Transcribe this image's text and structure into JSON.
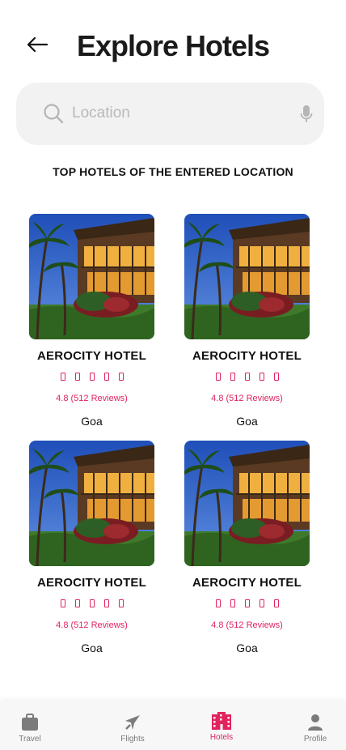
{
  "header": {
    "title": "Explore Hotels"
  },
  "search": {
    "placeholder": "Location",
    "value": ""
  },
  "section_title": "TOP HOTELS OF THE ENTERED LOCATION",
  "hotels": [
    {
      "name": "AEROCITY HOTEL",
      "rating_text": "4.8 (512 Reviews)",
      "city": "Goa",
      "stars": 5
    },
    {
      "name": "AEROCITY HOTEL",
      "rating_text": "4.8 (512 Reviews)",
      "city": "Goa",
      "stars": 5
    },
    {
      "name": "AEROCITY HOTEL",
      "rating_text": "4.8 (512 Reviews)",
      "city": "Goa",
      "stars": 5
    },
    {
      "name": "AEROCITY HOTEL",
      "rating_text": "4.8 (512 Reviews)",
      "city": "Goa",
      "stars": 5
    }
  ],
  "nav": [
    {
      "label": "Travel",
      "icon": "briefcase-icon",
      "active": false
    },
    {
      "label": "Flights",
      "icon": "airplane-icon",
      "active": false
    },
    {
      "label": "Hotels",
      "icon": "hotel-building-icon",
      "active": true
    },
    {
      "label": "Profile",
      "icon": "person-icon",
      "active": false
    }
  ],
  "colors": {
    "accent": "#e0245e",
    "search_bg": "#f2f2f2",
    "nav_bg": "#f7f7f7"
  }
}
